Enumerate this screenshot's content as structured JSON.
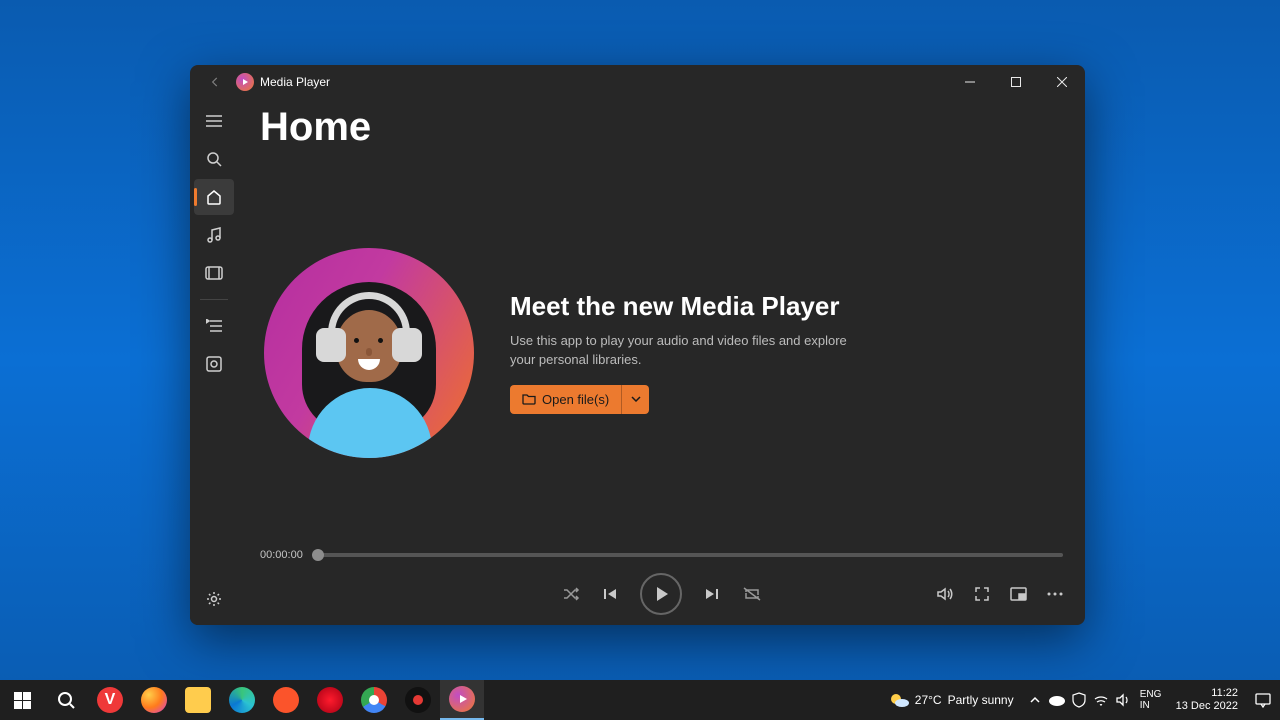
{
  "window": {
    "app_title": "Media Player",
    "page_title": "Home",
    "hero": {
      "heading": "Meet the new Media Player",
      "subtext": "Use this app to play your audio and video files and explore your personal libraries.",
      "open_button_label": "Open file(s)"
    },
    "sidebar": {
      "items": [
        {
          "id": "hamburger",
          "icon": "menu-icon"
        },
        {
          "id": "search",
          "icon": "search-icon"
        },
        {
          "id": "home",
          "icon": "home-icon",
          "active": true
        },
        {
          "id": "music",
          "icon": "music-icon"
        },
        {
          "id": "video",
          "icon": "video-icon"
        },
        {
          "id": "sep"
        },
        {
          "id": "queue",
          "icon": "queue-icon"
        },
        {
          "id": "playlists",
          "icon": "playlist-icon"
        }
      ],
      "footer": {
        "id": "settings",
        "icon": "settings-icon"
      }
    },
    "player": {
      "current_time": "00:00:00"
    }
  },
  "taskbar": {
    "weather": {
      "temp": "27°C",
      "desc": "Partly sunny"
    },
    "time": "11:22",
    "date": "13 Dec 2022"
  },
  "colors": {
    "accent": "#ec7a2f"
  }
}
